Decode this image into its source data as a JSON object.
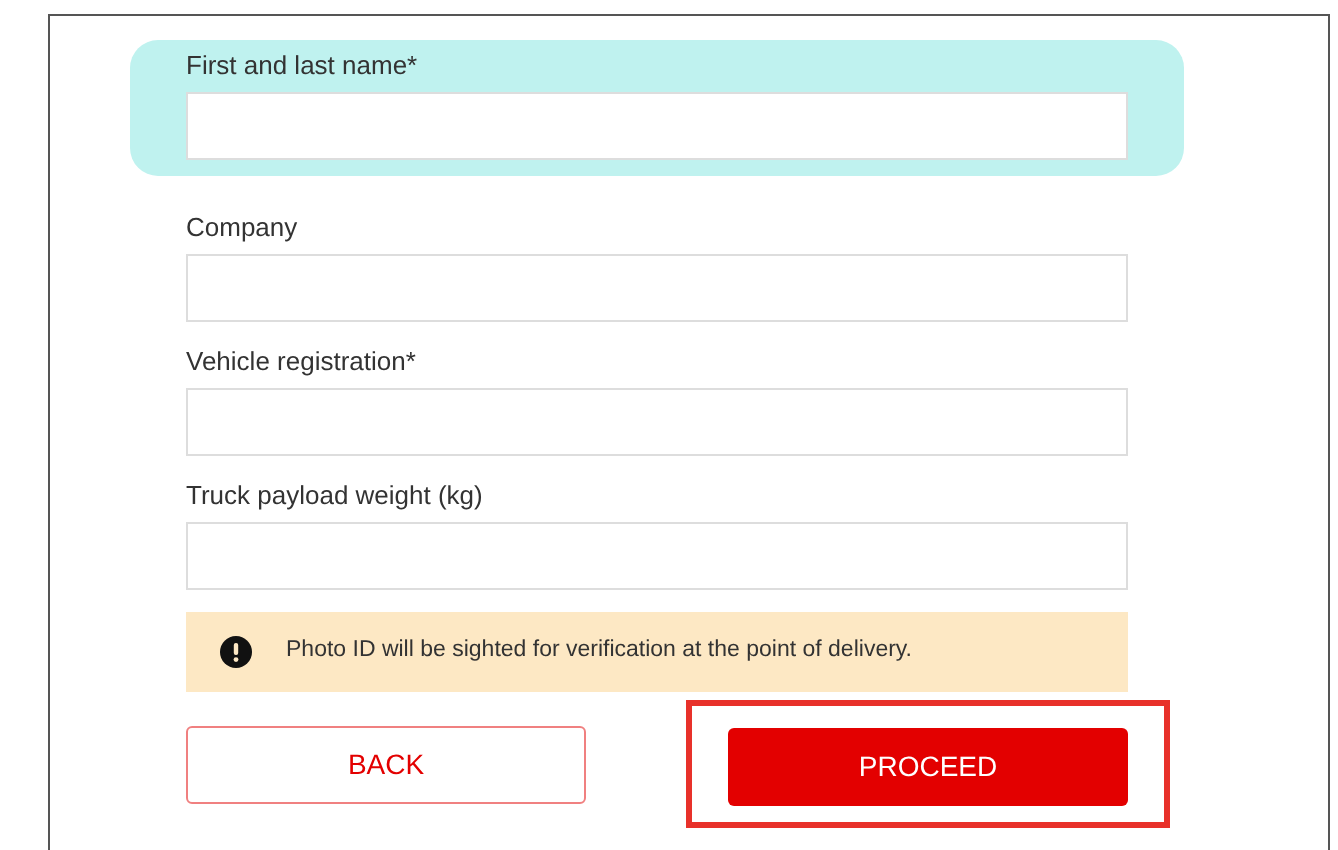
{
  "fields": [
    {
      "label": "First and last name*",
      "highlighted": true
    },
    {
      "label": "Company",
      "highlighted": false
    },
    {
      "label": "Vehicle registration*",
      "highlighted": false
    },
    {
      "label": "Truck payload weight (kg)",
      "highlighted": false
    }
  ],
  "notice": {
    "text": "Photo ID will be sighted for verification at the point of delivery."
  },
  "buttons": [
    {
      "label": "BACK",
      "kind": "secondary",
      "highlighted": false
    },
    {
      "label": "PROCEED",
      "kind": "primary",
      "highlighted": true
    }
  ]
}
